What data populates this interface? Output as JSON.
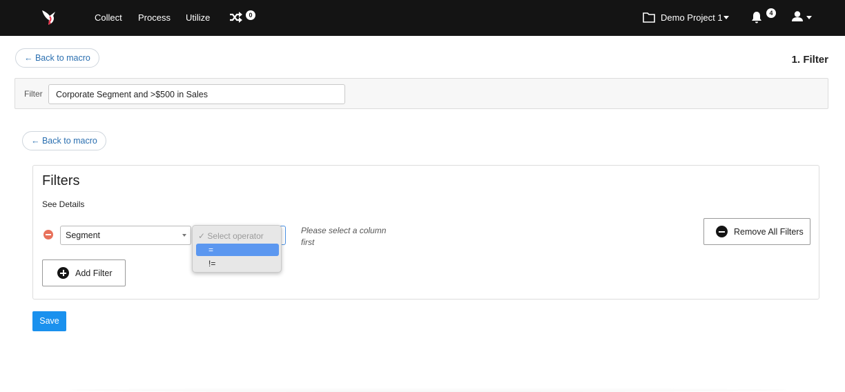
{
  "nav": {
    "items": [
      {
        "label": "Collect"
      },
      {
        "label": "Process"
      },
      {
        "label": "Utilize"
      }
    ],
    "shuffle_badge": "0",
    "project_label": "Demo Project 1",
    "notification_badge": "4"
  },
  "header": {
    "back_top": "← Back to macro",
    "step_title": "1. Filter"
  },
  "filter_bar": {
    "label": "Filter",
    "value": "Corporate Segment and >$500 in Sales"
  },
  "back_second": "← Back to macro",
  "filters_panel": {
    "title": "Filters",
    "see_details": "See Details",
    "column_value": "Segment",
    "hint": "Please select a column first",
    "add_filter": "Add Filter",
    "remove_all": "Remove All Filters"
  },
  "operator_dropdown": {
    "placeholder": "✓ Select operator",
    "options": [
      {
        "label": "=",
        "selected": true
      },
      {
        "label": "!=",
        "selected": false
      }
    ]
  },
  "save_label": "Save",
  "colors": {
    "topbar": "#141414",
    "primary": "#1a91ee",
    "remove_red": "#e8715b",
    "dropdown_highlight": "#5b97f0"
  }
}
